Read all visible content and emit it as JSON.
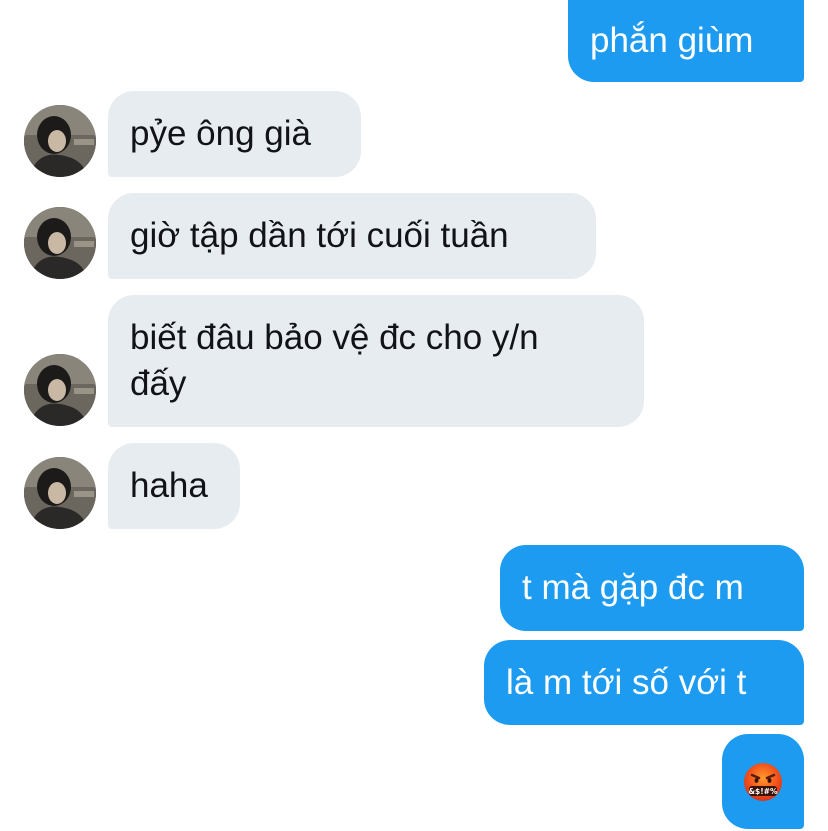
{
  "colors": {
    "outgoing_bubble": "#1d9bf0",
    "incoming_bubble": "#e7ecf0",
    "incoming_text": "#111316",
    "outgoing_text": "#ffffff"
  },
  "messages": [
    {
      "direction": "outgoing",
      "text": "phắn giùm"
    },
    {
      "direction": "incoming",
      "text": "pỷe ông già"
    },
    {
      "direction": "incoming",
      "text": "giờ tập dần tới cuối tuần"
    },
    {
      "direction": "incoming",
      "text": "biết đâu bảo vệ đc cho y/n\nđấy"
    },
    {
      "direction": "incoming",
      "text": "haha"
    },
    {
      "direction": "outgoing",
      "text": "t mà gặp đc m"
    },
    {
      "direction": "outgoing",
      "text": "là m tới số với t"
    },
    {
      "direction": "outgoing",
      "emoji": "face-with-symbols-on-mouth",
      "emoji_text": "&$!#%"
    }
  ]
}
